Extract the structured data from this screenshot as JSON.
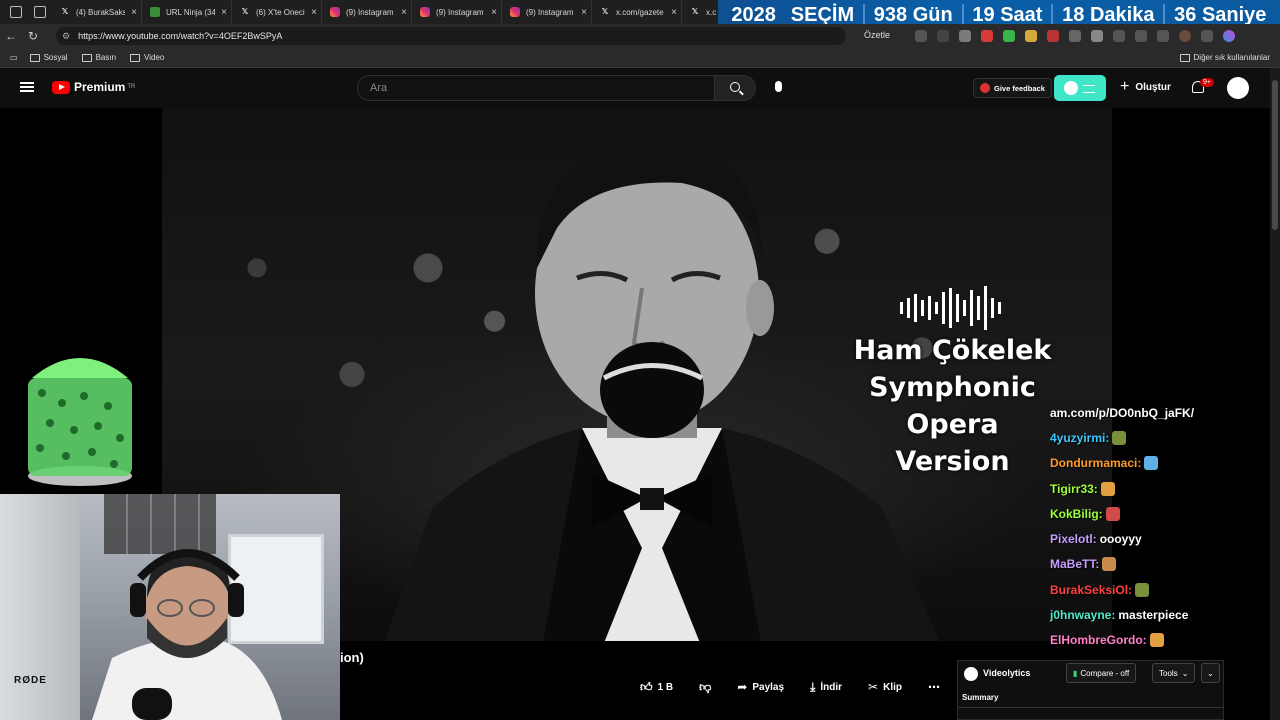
{
  "browser": {
    "tabs": [
      {
        "icon": "x-icon",
        "title": "(4) BurakSaks"
      },
      {
        "icon": "url-ninja-icon",
        "title": "URL Ninja (34"
      },
      {
        "icon": "x-icon",
        "title": "(6) X'te Oneci"
      },
      {
        "icon": "instagram-icon",
        "title": "(9) Instagram"
      },
      {
        "icon": "instagram-icon",
        "title": "(9) Instagram"
      },
      {
        "icon": "instagram-icon",
        "title": "(9) Instagram"
      },
      {
        "icon": "x-icon",
        "title": "x.com/gazete"
      },
      {
        "icon": "x-icon",
        "title": "x.c"
      }
    ],
    "url": "https://www.youtube.com/watch?v=4OEF2BwSPyA",
    "summarize_label": "Özetle",
    "bookmarks": [
      "Sosyal",
      "Basın",
      "Video"
    ],
    "other_bookmarks": "Diğer sık kullanılanlar"
  },
  "countdown": {
    "year": "2028",
    "event": "SEÇİM",
    "days": "938 Gün",
    "hours": "19 Saat",
    "minutes": "18 Dakika",
    "seconds": "36 Saniye",
    "bg_color": "#0b5aa0"
  },
  "youtube": {
    "logo_text": "Premium",
    "region": "TR",
    "search_placeholder": "Ara",
    "feedback_label": "Give feedback",
    "create_label": "Oluştur",
    "notification_count": "9+"
  },
  "video": {
    "overlay_title_lines": [
      "Ham Çökelek",
      "Symphonic",
      "Opera Version"
    ],
    "title_fragment": "ion)",
    "like_count": "1 B",
    "share_label": "Paylaş",
    "download_label": "İndir",
    "clip_label": "Klip"
  },
  "chat": {
    "messages": [
      {
        "user": "",
        "text": "am.com/p/DO0nbQ_jaFK/",
        "color": "#ffffff"
      },
      {
        "user": "4yuzyirmi:",
        "text": "",
        "color": "#3ec7ff"
      },
      {
        "user": "Dondurmamaci:",
        "text": "",
        "color": "#ff9c2a"
      },
      {
        "user": "Tigirr33:",
        "text": "",
        "color": "#9dff3b"
      },
      {
        "user": "KokBilig:",
        "text": "",
        "color": "#9dff3b"
      },
      {
        "user": "Pixelotl:",
        "text": "oooyyy",
        "color": "#c79cff"
      },
      {
        "user": "MaBeTT:",
        "text": "",
        "color": "#c79cff"
      },
      {
        "user": "BurakSeksiOl:",
        "text": "",
        "color": "#ff4040"
      },
      {
        "user": "j0hnwayne:",
        "text": "masterpiece",
        "color": "#4fe9c9"
      },
      {
        "user": "ElHombreGordo:",
        "text": "",
        "color": "#ff80c9"
      }
    ]
  },
  "webcam": {
    "mic_brand": "RØDE"
  },
  "videolytics": {
    "name": "Videolytics",
    "compare_label": "Compare - off",
    "tools_label": "Tools",
    "summary_label": "Summary"
  }
}
